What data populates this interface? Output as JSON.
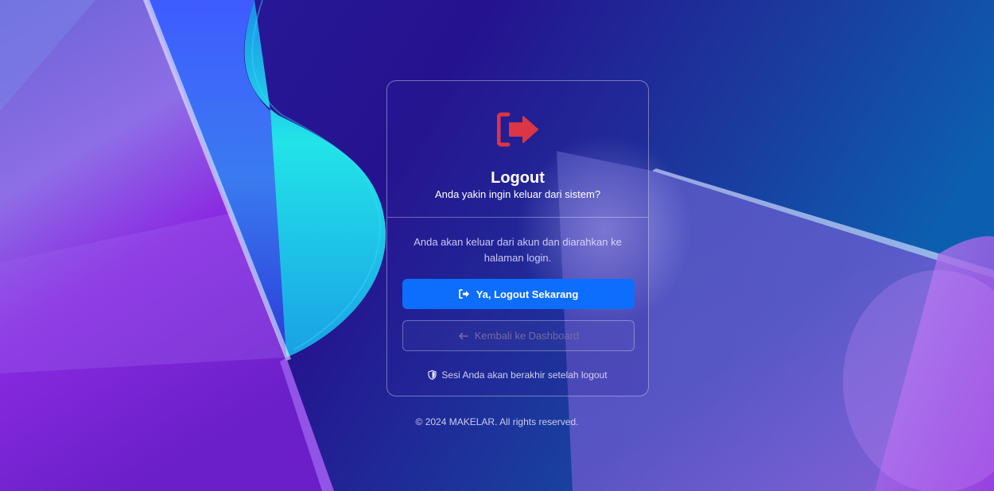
{
  "card": {
    "icon": "logout-icon",
    "title": "Logout",
    "subtitle": "Anda yakin ingin keluar dari sistem?",
    "description": "Anda akan keluar dari akun dan diarahkan ke halaman login.",
    "confirm_button": {
      "label": "Ya, Logout Sekarang",
      "icon": "logout-icon"
    },
    "back_button": {
      "label": "Kembali ke Dashboard",
      "icon": "arrow-left-icon"
    },
    "session_note": {
      "text": "Sesi Anda akan berakhir setelah logout",
      "icon": "shield-icon"
    }
  },
  "footer": {
    "text": "© 2024 MAKELAR. All rights reserved."
  },
  "colors": {
    "accent": "#0d6efd",
    "danger": "#dc3545",
    "background": "#2a1490"
  }
}
